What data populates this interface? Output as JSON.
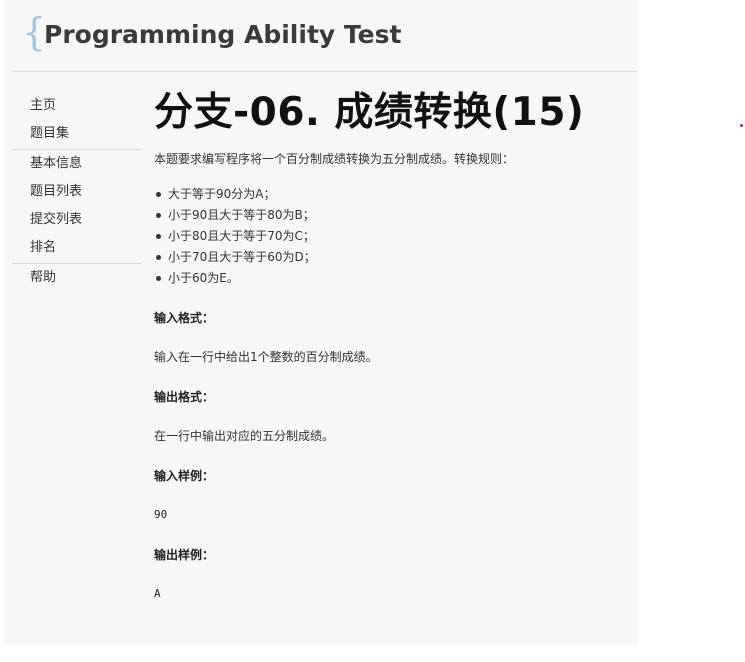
{
  "header": {
    "brace": "{",
    "site_title": "Programming Ability Test"
  },
  "sidebar": {
    "items": [
      {
        "label": "主页"
      },
      {
        "label": "题目集"
      },
      {
        "label": "基本信息"
      },
      {
        "label": "题目列表"
      },
      {
        "label": "提交列表"
      },
      {
        "label": "排名"
      },
      {
        "label": "帮助"
      }
    ]
  },
  "problem": {
    "title": "分支-06. 成绩转换(15)",
    "intro": "本题要求编写程序将一个百分制成绩转换为五分制成绩。转换规则：",
    "rules": [
      "大于等于90分为A；",
      "小于90且大于等于80为B；",
      "小于80且大于等于70为C；",
      "小于70且大于等于60为D；",
      "小于60为E。"
    ],
    "input_format_title": "输入格式：",
    "input_format_text": "输入在一行中给出1个整数的百分制成绩。",
    "output_format_title": "输出格式：",
    "output_format_text": "在一行中输出对应的五分制成绩。",
    "sample_input_title": "输入样例：",
    "sample_input": "90",
    "sample_output_title": "输出样例：",
    "sample_output": "A"
  },
  "colors": {
    "brace": "#9ec5e4",
    "panel_bg": "#f7f7f7",
    "marker": "#e02020"
  }
}
